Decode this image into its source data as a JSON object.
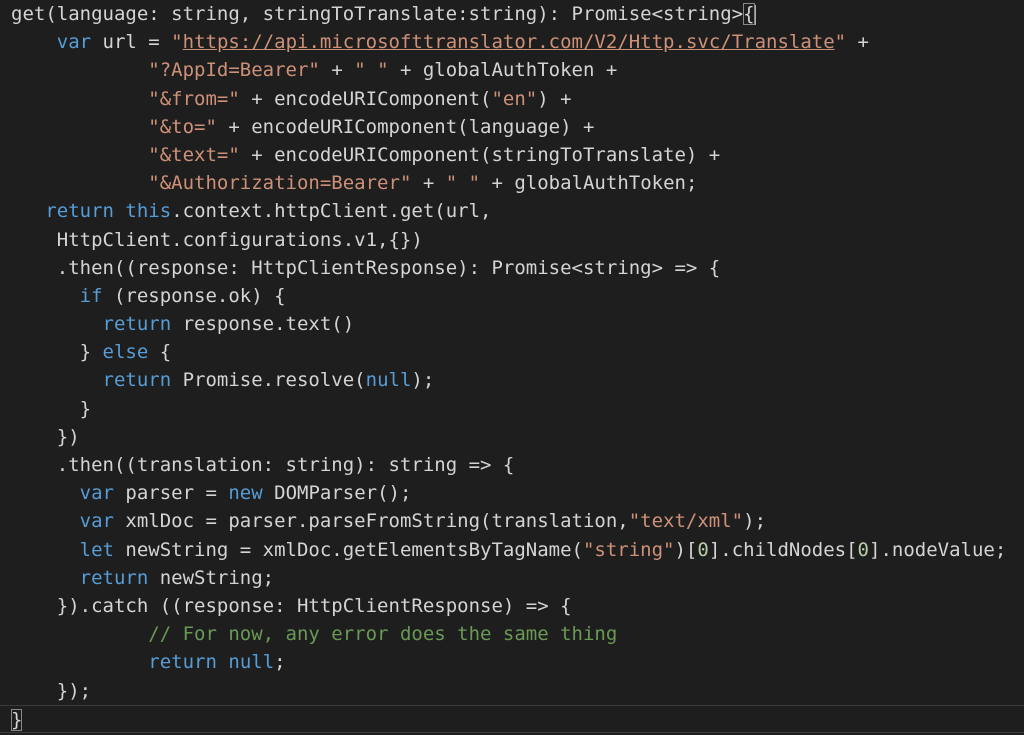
{
  "lines": [
    {
      "indent": 0,
      "tokens": [
        [
          "p",
          "get(language: string, stringToTranslate:string): Promise<string>"
        ],
        [
          "bm",
          "{"
        ]
      ]
    },
    {
      "indent": 4,
      "tokens": [
        [
          "kw",
          "var"
        ],
        [
          "p",
          " url = "
        ],
        [
          "str",
          "\""
        ],
        [
          "url",
          "https://api.microsofttranslator.com/V2/Http.svc/Translate"
        ],
        [
          "str",
          "\""
        ],
        [
          "p",
          " +"
        ]
      ]
    },
    {
      "indent": 12,
      "tokens": [
        [
          "str",
          "\"?AppId=Bearer\""
        ],
        [
          "p",
          " + "
        ],
        [
          "str",
          "\" \""
        ],
        [
          "p",
          " + globalAuthToken +"
        ]
      ]
    },
    {
      "indent": 12,
      "tokens": [
        [
          "str",
          "\"&from=\""
        ],
        [
          "p",
          " + encodeURIComponent("
        ],
        [
          "str",
          "\"en\""
        ],
        [
          "p",
          ") +"
        ]
      ]
    },
    {
      "indent": 12,
      "tokens": [
        [
          "str",
          "\"&to=\""
        ],
        [
          "p",
          " + encodeURIComponent(language) +"
        ]
      ]
    },
    {
      "indent": 12,
      "tokens": [
        [
          "str",
          "\"&text=\""
        ],
        [
          "p",
          " + encodeURIComponent(stringToTranslate) +"
        ]
      ]
    },
    {
      "indent": 12,
      "tokens": [
        [
          "str",
          "\"&Authorization=Bearer\""
        ],
        [
          "p",
          " + "
        ],
        [
          "str",
          "\" \""
        ],
        [
          "p",
          " + globalAuthToken;"
        ]
      ]
    },
    {
      "indent": 3,
      "tokens": [
        [
          "kw",
          "return"
        ],
        [
          "p",
          " "
        ],
        [
          "kw",
          "this"
        ],
        [
          "p",
          ".context.httpClient.get(url,"
        ]
      ]
    },
    {
      "indent": 4,
      "tokens": [
        [
          "p",
          "HttpClient.configurations.v1,{})"
        ]
      ]
    },
    {
      "indent": 4,
      "tokens": [
        [
          "p",
          ".then((response: HttpClientResponse): Promise<string> => {"
        ]
      ]
    },
    {
      "indent": 6,
      "tokens": [
        [
          "kw",
          "if"
        ],
        [
          "p",
          " (response.ok) {"
        ]
      ]
    },
    {
      "indent": 8,
      "tokens": [
        [
          "kw",
          "return"
        ],
        [
          "p",
          " response.text()"
        ]
      ]
    },
    {
      "indent": 6,
      "tokens": [
        [
          "p",
          "} "
        ],
        [
          "kw",
          "else"
        ],
        [
          "p",
          " {"
        ]
      ]
    },
    {
      "indent": 8,
      "tokens": [
        [
          "kw",
          "return"
        ],
        [
          "p",
          " Promise.resolve("
        ],
        [
          "kw",
          "null"
        ],
        [
          "p",
          ");"
        ]
      ]
    },
    {
      "indent": 6,
      "tokens": [
        [
          "p",
          "}"
        ]
      ]
    },
    {
      "indent": 4,
      "tokens": [
        [
          "p",
          "})"
        ]
      ]
    },
    {
      "indent": 4,
      "tokens": [
        [
          "p",
          ".then((translation: string): string => {"
        ]
      ]
    },
    {
      "indent": 6,
      "tokens": [
        [
          "kw",
          "var"
        ],
        [
          "p",
          " parser = "
        ],
        [
          "kw",
          "new"
        ],
        [
          "p",
          " DOMParser();"
        ]
      ]
    },
    {
      "indent": 6,
      "tokens": [
        [
          "kw",
          "var"
        ],
        [
          "p",
          " xmlDoc = parser.parseFromString(translation,"
        ],
        [
          "str",
          "\"text/xml\""
        ],
        [
          "p",
          ");"
        ]
      ]
    },
    {
      "indent": 6,
      "tokens": [
        [
          "kw",
          "let"
        ],
        [
          "p",
          " newString = xmlDoc.getElementsByTagName("
        ],
        [
          "str",
          "\"string\""
        ],
        [
          "p",
          ")["
        ],
        [
          "num",
          "0"
        ],
        [
          "p",
          "].childNodes["
        ],
        [
          "num",
          "0"
        ],
        [
          "p",
          "].nodeValue;"
        ]
      ]
    },
    {
      "indent": 6,
      "tokens": [
        [
          "kw",
          "return"
        ],
        [
          "p",
          " newString;"
        ]
      ]
    },
    {
      "indent": 4,
      "tokens": [
        [
          "p",
          "}).catch ((response: HttpClientResponse) => {"
        ]
      ]
    },
    {
      "indent": 12,
      "tokens": [
        [
          "cmt",
          "// For now, any error does the same thing"
        ]
      ]
    },
    {
      "indent": 12,
      "tokens": [
        [
          "kw",
          "return"
        ],
        [
          "p",
          " "
        ],
        [
          "kw",
          "null"
        ],
        [
          "p",
          ";"
        ]
      ]
    },
    {
      "indent": 4,
      "tokens": [
        [
          "p",
          "});"
        ]
      ]
    },
    {
      "indent": 0,
      "current": true,
      "tokens": [
        [
          "bm",
          "}"
        ]
      ]
    }
  ],
  "colors": {
    "background": "#1e1e1e",
    "text": "#d4d4d4",
    "keyword": "#569cd6",
    "string": "#ce9178",
    "number": "#b5cea8",
    "comment": "#6a9955"
  }
}
